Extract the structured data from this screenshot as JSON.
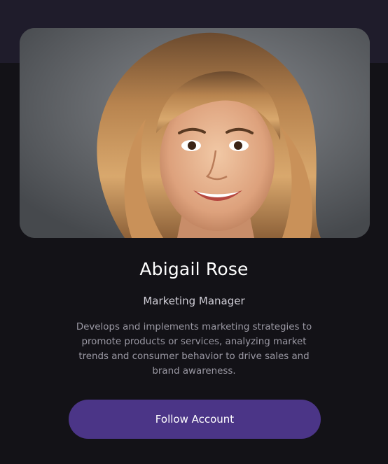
{
  "profile": {
    "name": "Abigail Rose",
    "role": "Marketing Manager",
    "bio": "Develops and implements marketing strategies to promote products or services, analyzing market trends and consumer behavior to drive sales and brand awareness.",
    "photo_icon": "profile-photo"
  },
  "actions": {
    "follow_label": "Follow Account"
  },
  "colors": {
    "background": "#131217",
    "header_band": "#1f1c2b",
    "button": "#4b3587",
    "name_text": "#ffffff",
    "role_text": "#cfcdd6",
    "bio_text": "#9a98a3"
  }
}
